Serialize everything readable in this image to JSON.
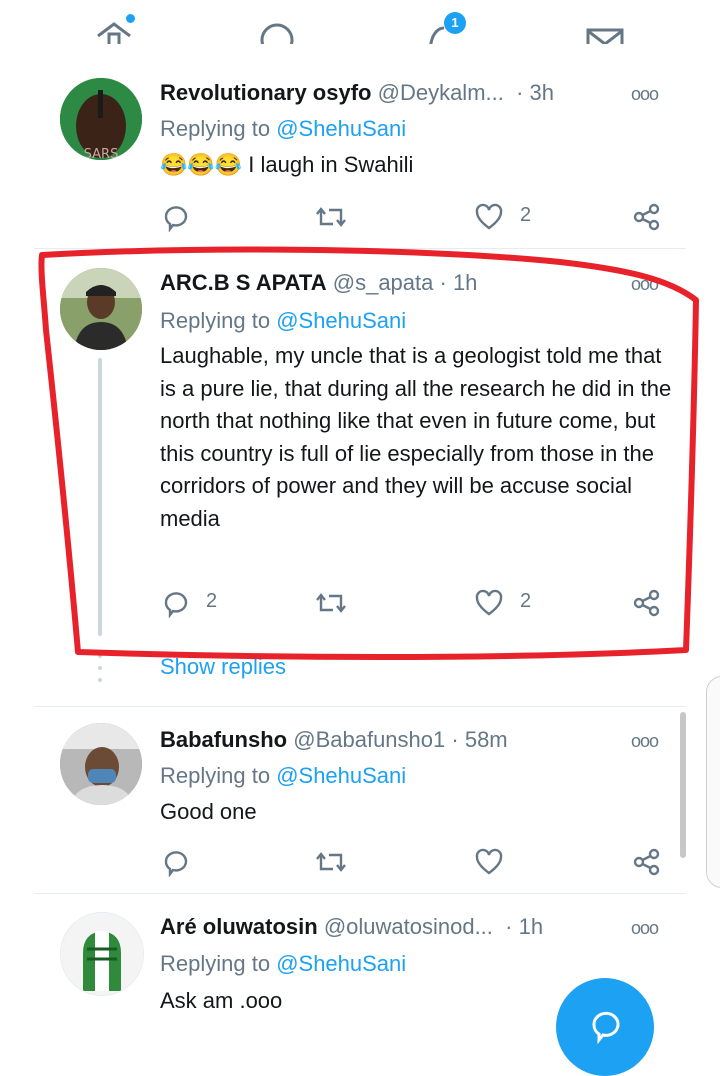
{
  "nav": {
    "notifications_badge": "1"
  },
  "tweets": [
    {
      "name": "Revolutionary osyfo",
      "handle": "@Deykalm...",
      "time": "· 3h",
      "replying_prefix": "Replying to ",
      "replying_to": "@ShehuSani",
      "text": "😂😂😂 I laugh in Swahili",
      "reply_count": "",
      "retweet_count": "",
      "like_count": "2",
      "avatar_text": "SARS"
    },
    {
      "name": "ARC.B S APATA",
      "handle": "@s_apata",
      "time": "· 1h",
      "replying_prefix": "Replying to ",
      "replying_to": "@ShehuSani",
      "text": "Laughable, my uncle that is a geologist told me that is a pure lie, that during all the research he did in the north that nothing like that even in future  come, but this country is full of lie especially from those in the corridors of power and they will be accuse social media",
      "reply_count": "2",
      "retweet_count": "",
      "like_count": "2"
    },
    {
      "name": "Babafunsho",
      "handle": "@Babafunsho1",
      "time": "· 58m",
      "replying_prefix": "Replying to ",
      "replying_to": "@ShehuSani",
      "text": "Good one",
      "reply_count": "",
      "retweet_count": "",
      "like_count": ""
    },
    {
      "name": "Aré oluwatosin",
      "handle": "@oluwatosinod...",
      "time": "· 1h",
      "replying_prefix": "Replying to ",
      "replying_to": "@ShehuSani",
      "text": "Ask am .ooo"
    }
  ],
  "show_replies": "Show replies",
  "colors": {
    "accent": "#1da1f2",
    "muted": "#657786",
    "highlight": "#e8222a"
  }
}
